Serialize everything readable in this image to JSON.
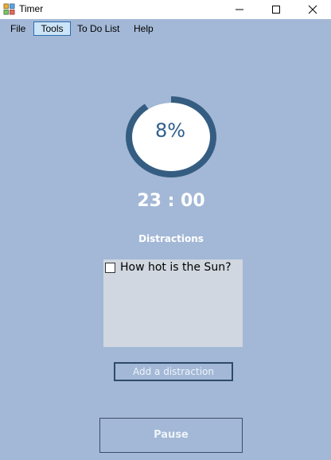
{
  "window": {
    "title": "Timer"
  },
  "menu": {
    "items": [
      "File",
      "Tools",
      "To Do List",
      "Help"
    ],
    "active": "Tools"
  },
  "timer": {
    "progress_label": "8%",
    "progress_fraction": 0.08,
    "time": "23 : 00"
  },
  "distractions": {
    "label": "Distractions",
    "items": [
      {
        "text": "How hot is the Sun?",
        "checked": false
      }
    ],
    "add_label": "Add a distraction"
  },
  "controls": {
    "pause_label": "Pause"
  },
  "colors": {
    "background": "#a3b8d6",
    "ring": "#355d82",
    "ring_inner": "#ffffff",
    "percent_text": "#2f5f8c",
    "list_bg": "#d0d7e0",
    "menu_highlight": "#cce4f7"
  },
  "icons": {
    "app": "app-icon",
    "minimize": "minimize-icon",
    "maximize": "maximize-icon",
    "close": "close-icon"
  }
}
